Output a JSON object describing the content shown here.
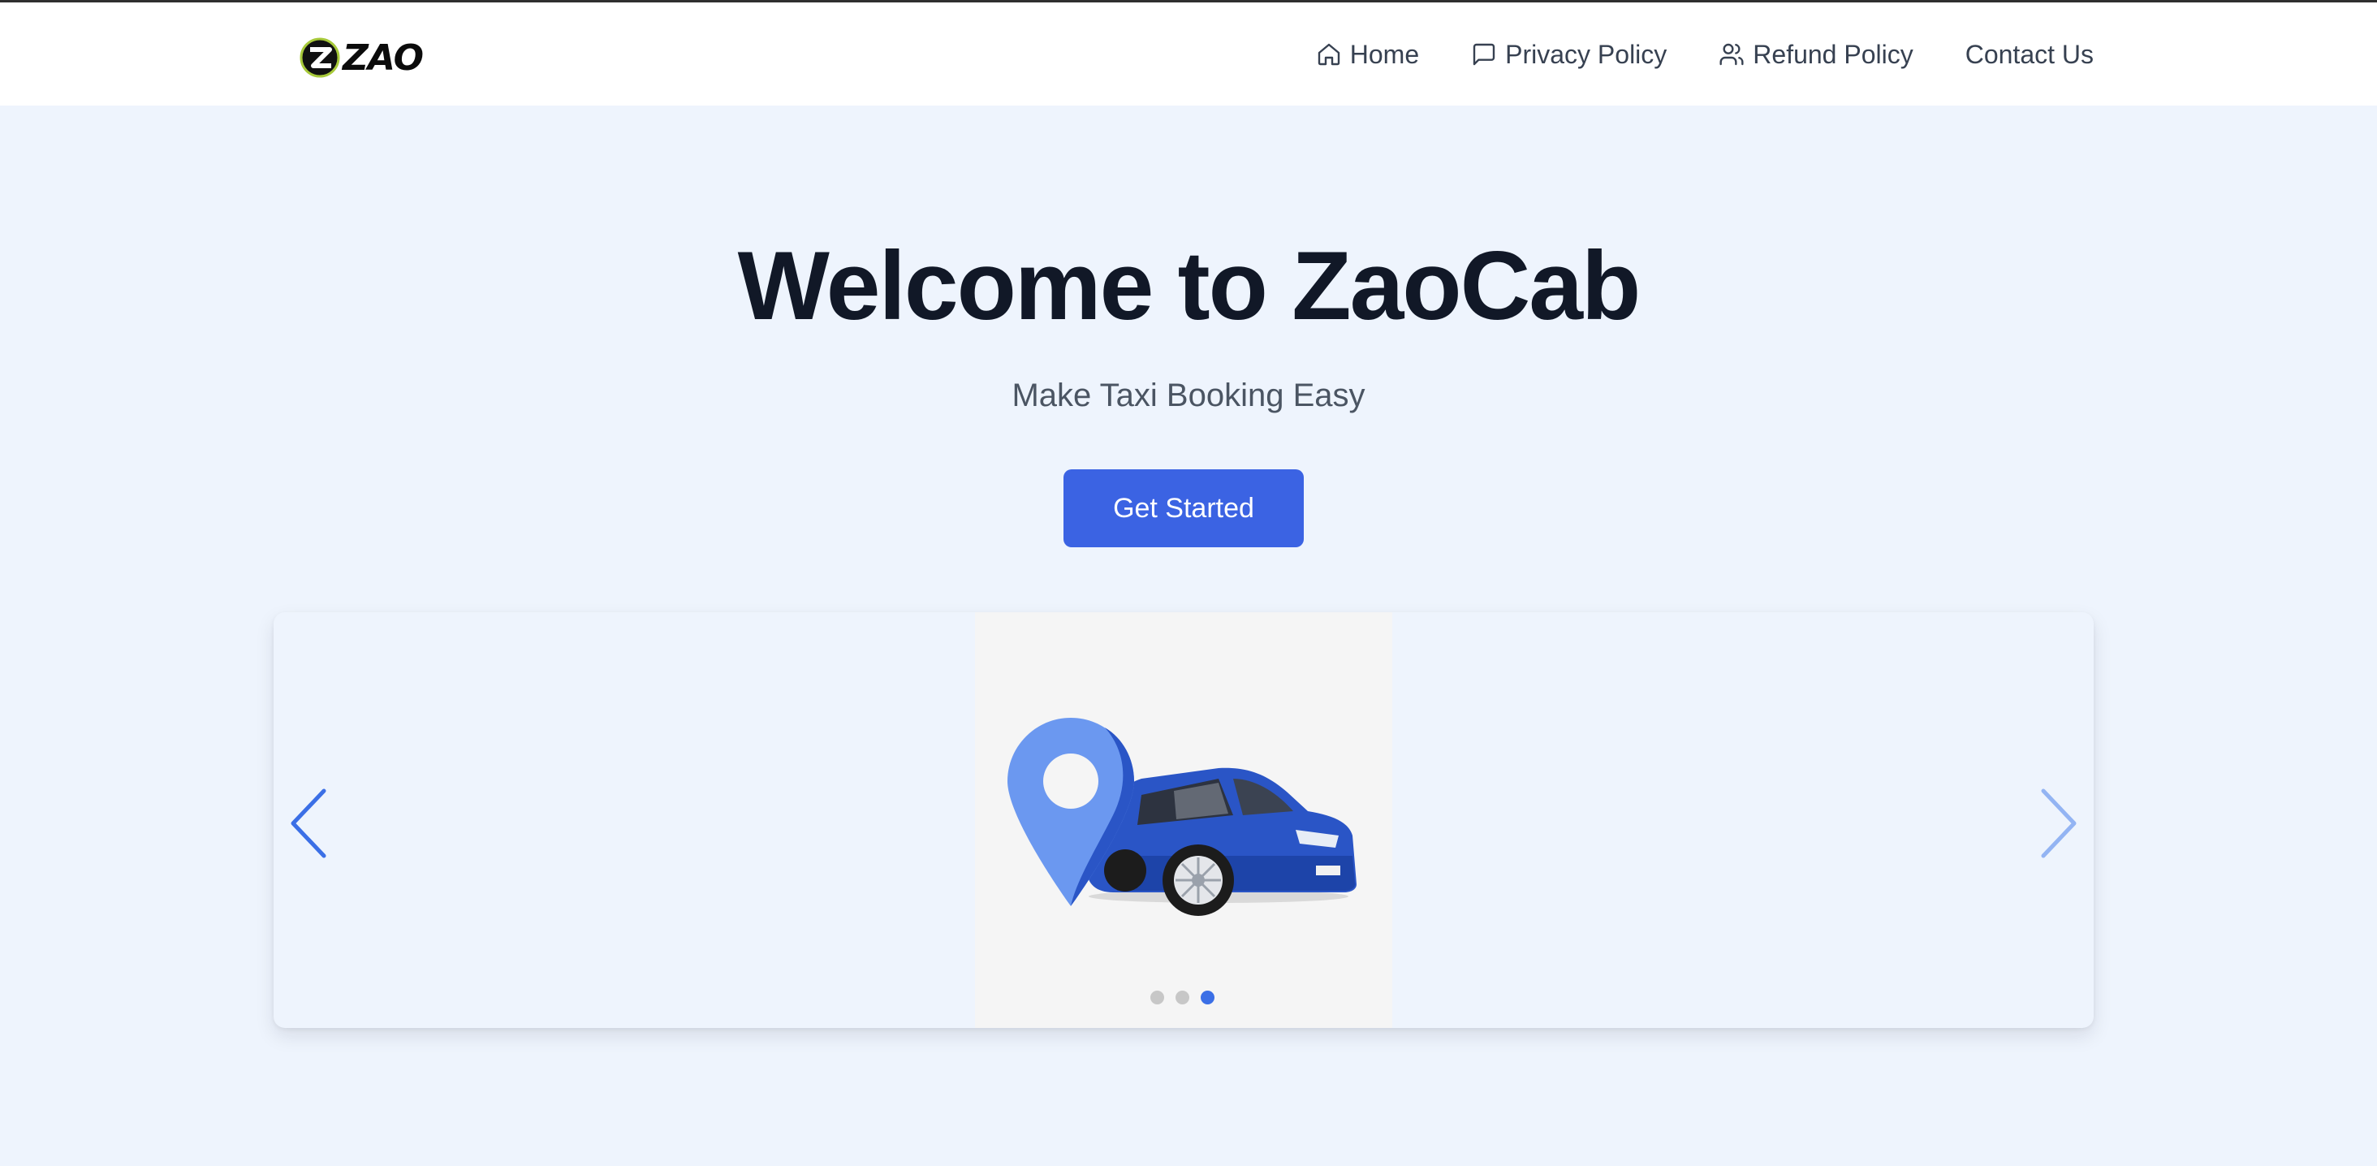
{
  "brand": {
    "logo_text": "ZAO"
  },
  "nav": {
    "items": [
      {
        "label": "Home",
        "icon": "home-icon"
      },
      {
        "label": "Privacy Policy",
        "icon": "message-square-icon"
      },
      {
        "label": "Refund Policy",
        "icon": "users-icon"
      },
      {
        "label": "Contact Us",
        "icon": ""
      }
    ]
  },
  "hero": {
    "title": "Welcome to ZaoCab",
    "subtitle": "Make Taxi Booking Easy",
    "cta_label": "Get Started"
  },
  "carousel": {
    "slide_count": 3,
    "active_index": 2,
    "slide_image": "location-pin-and-blue-car-illustration",
    "prev_icon": "chevron-left-icon",
    "next_icon": "chevron-right-icon"
  },
  "colors": {
    "primary": "#3b63e3",
    "hero_bg": "#eef4fd",
    "title": "#111827",
    "nav_text": "#374151",
    "dot_active": "#3b6fe6",
    "dot_inactive": "#c7c7c7"
  }
}
